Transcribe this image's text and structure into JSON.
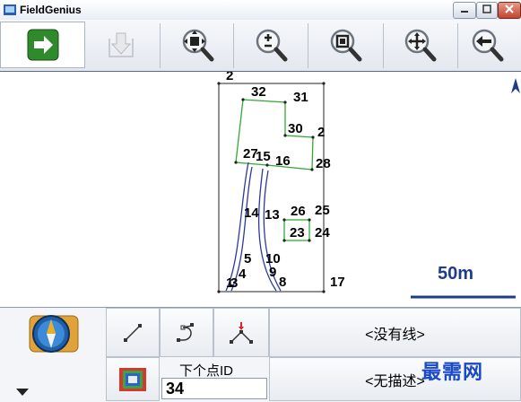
{
  "window": {
    "title": "FieldGenius"
  },
  "toolbar": {
    "buttons": [
      {
        "name": "next-arrow-button",
        "icon": "arrow-right-icon"
      },
      {
        "name": "download-button",
        "icon": "download-icon"
      },
      {
        "name": "zoom-extents-button",
        "icon": "zoom-extents-icon"
      },
      {
        "name": "zoom-in-out-button",
        "icon": "zoom-plus-minus-icon"
      },
      {
        "name": "zoom-window-button",
        "icon": "zoom-window-icon"
      },
      {
        "name": "pan-button",
        "icon": "pan-icon"
      },
      {
        "name": "back-button",
        "icon": "zoom-back-icon"
      }
    ]
  },
  "map": {
    "point_labels": [
      "2",
      "32",
      "31",
      "30",
      "2",
      "27",
      "15",
      "16",
      "28",
      "14",
      "13",
      "26",
      "25",
      "23",
      "24",
      "5",
      "10",
      "4",
      "9",
      "3",
      "1",
      "8",
      "17"
    ],
    "scale_text": "50m",
    "north_icon": "north-arrow-icon"
  },
  "bottom": {
    "line_status": "<没有线>",
    "desc_status": "<无描述>",
    "next_point_label": "下个点ID",
    "next_point_value": "34",
    "watermark": "最需网"
  },
  "colors": {
    "linework": "#33aa33",
    "road": "#2b3a9a",
    "scale_bar": "#1f3b8c"
  }
}
